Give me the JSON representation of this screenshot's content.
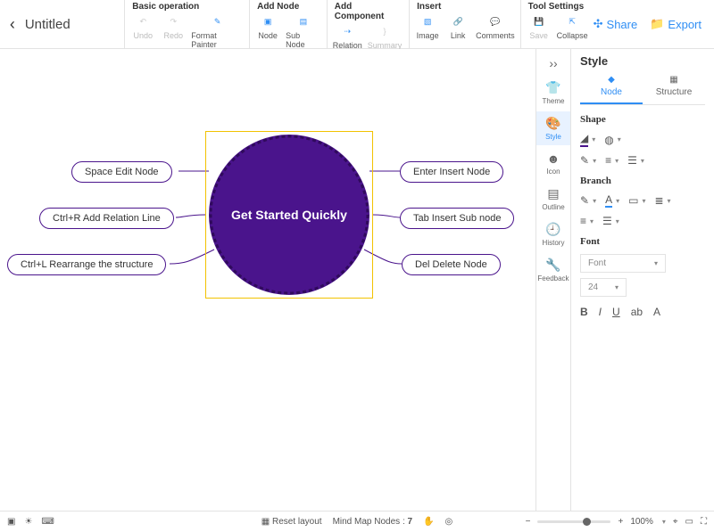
{
  "doc": {
    "title": "Untitled"
  },
  "toolbar": {
    "groups": [
      {
        "label": "Basic operation",
        "items": [
          {
            "name": "undo",
            "label": "Undo",
            "disabled": true
          },
          {
            "name": "redo",
            "label": "Redo",
            "disabled": true
          },
          {
            "name": "format-painter",
            "label": "Format Painter"
          }
        ]
      },
      {
        "label": "Add Node",
        "items": [
          {
            "name": "node",
            "label": "Node"
          },
          {
            "name": "sub-node",
            "label": "Sub Node"
          }
        ]
      },
      {
        "label": "Add Component",
        "items": [
          {
            "name": "relation",
            "label": "Relation"
          },
          {
            "name": "summary",
            "label": "Summary",
            "disabled": true
          }
        ]
      },
      {
        "label": "Insert",
        "items": [
          {
            "name": "image",
            "label": "Image"
          },
          {
            "name": "link",
            "label": "Link"
          },
          {
            "name": "comments",
            "label": "Comments"
          }
        ]
      },
      {
        "label": "Tool Settings",
        "items": [
          {
            "name": "save",
            "label": "Save",
            "disabled": true
          },
          {
            "name": "collapse",
            "label": "Collapse"
          }
        ]
      }
    ],
    "actions": {
      "share": "Share",
      "export": "Export"
    }
  },
  "mindmap": {
    "center": "Get Started Quickly",
    "left": [
      "Space Edit Node",
      "Ctrl+R Add Relation Line",
      "Ctrl+L Rearrange the structure"
    ],
    "right": [
      "Enter Insert Node",
      "Tab Insert Sub node",
      "Del Delete Node"
    ]
  },
  "rail": [
    {
      "name": "theme",
      "label": "Theme"
    },
    {
      "name": "style",
      "label": "Style",
      "active": true
    },
    {
      "name": "icon",
      "label": "Icon"
    },
    {
      "name": "outline",
      "label": "Outline"
    },
    {
      "name": "history",
      "label": "History"
    },
    {
      "name": "feedback",
      "label": "Feedback"
    }
  ],
  "panel": {
    "title": "Style",
    "tabs": {
      "node": "Node",
      "structure": "Structure"
    },
    "sections": {
      "shape": "Shape",
      "branch": "Branch",
      "font": "Font"
    },
    "font": {
      "family": "Font",
      "size": "24"
    }
  },
  "status": {
    "reset": "Reset layout",
    "nodes_label": "Mind Map Nodes :",
    "nodes_count": "7",
    "zoom": "100%"
  },
  "colors": {
    "accent": "#2f8ef4",
    "node": "#4a148c"
  }
}
